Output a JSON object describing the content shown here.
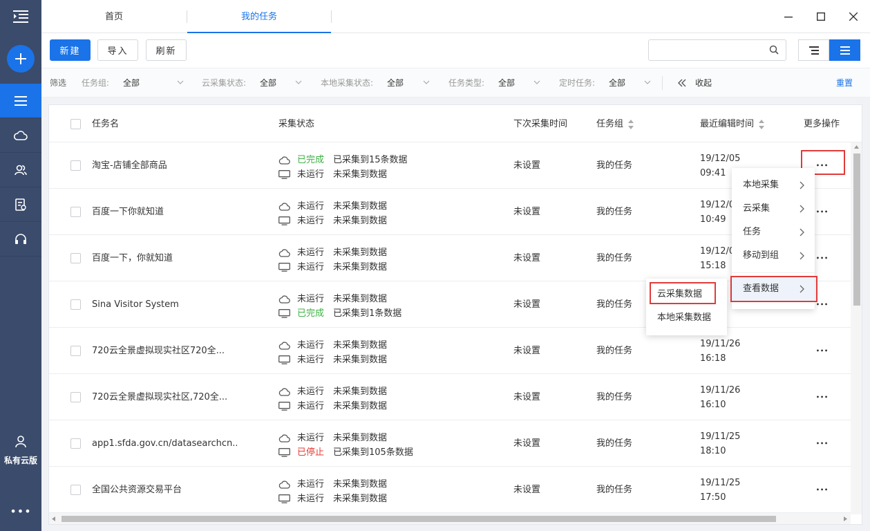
{
  "sidebar": {
    "user_label": "私有云版"
  },
  "tabs": [
    {
      "label": "首页"
    },
    {
      "label": "我的任务"
    }
  ],
  "toolbar": {
    "new_label": "新建",
    "import_label": "导入",
    "refresh_label": "刷新",
    "search_value": ""
  },
  "filters": {
    "label": "筛选",
    "task_group_label": "任务组:",
    "task_group_value": "全部",
    "cloud_status_label": "云采集状态:",
    "cloud_status_value": "全部",
    "local_status_label": "本地采集状态:",
    "local_status_value": "全部",
    "task_type_label": "任务类型:",
    "task_type_value": "全部",
    "scheduled_label": "定时任务:",
    "scheduled_value": "全部",
    "collapse_label": "收起",
    "reset_label": "重置"
  },
  "table": {
    "columns": {
      "name": "任务名",
      "status": "采集状态",
      "next_time": "下次采集时间",
      "group": "任务组",
      "edited": "最近编辑时间",
      "more": "更多操作"
    },
    "rows": [
      {
        "name": "淘宝-店铺全部商品",
        "cloud_state": "已完成",
        "cloud_state_type": "ok",
        "cloud_msg": "已采集到15条数据",
        "local_state": "未运行",
        "local_state_type": "",
        "local_msg": "未采集到数据",
        "next": "未设置",
        "group": "我的任务",
        "date": "19/12/05",
        "time": "09:41"
      },
      {
        "name": "百度一下你就知道",
        "cloud_state": "未运行",
        "cloud_state_type": "",
        "cloud_msg": "未采集到数据",
        "local_state": "未运行",
        "local_state_type": "",
        "local_msg": "未采集到数据",
        "next": "未设置",
        "group": "我的任务",
        "date": "19/12/0",
        "time": "10:49"
      },
      {
        "name": "百度一下，你就知道",
        "cloud_state": "未运行",
        "cloud_state_type": "",
        "cloud_msg": "未采集到数据",
        "local_state": "未运行",
        "local_state_type": "",
        "local_msg": "未采集到数据",
        "next": "未设置",
        "group": "我的任务",
        "date": "19/12/0",
        "time": "15:18"
      },
      {
        "name": "Sina Visitor System",
        "cloud_state": "未运行",
        "cloud_state_type": "",
        "cloud_msg": "未采集到数据",
        "local_state": "已完成",
        "local_state_type": "ok",
        "local_msg": "已采集到1条数据",
        "next": "未设置",
        "group": "我的任务",
        "date": "",
        "time": ""
      },
      {
        "name": "720云全景虚拟现实社区720全...",
        "cloud_state": "未运行",
        "cloud_state_type": "",
        "cloud_msg": "未采集到数据",
        "local_state": "未运行",
        "local_state_type": "",
        "local_msg": "未采集到数据",
        "next": "未设置",
        "group": "我的任务",
        "date": "19/11/26",
        "time": "16:18"
      },
      {
        "name": "720云全景虚拟现实社区,720全...",
        "cloud_state": "未运行",
        "cloud_state_type": "",
        "cloud_msg": "未采集到数据",
        "local_state": "未运行",
        "local_state_type": "",
        "local_msg": "未采集到数据",
        "next": "未设置",
        "group": "我的任务",
        "date": "19/11/26",
        "time": "16:10"
      },
      {
        "name": "app1.sfda.gov.cn/datasearchcn...",
        "cloud_state": "未运行",
        "cloud_state_type": "",
        "cloud_msg": "未采集到数据",
        "local_state": "已停止",
        "local_state_type": "stop",
        "local_msg": "已采集到105条数据",
        "next": "未设置",
        "group": "我的任务",
        "date": "19/11/25",
        "time": "18:10"
      },
      {
        "name": "全国公共资源交易平台",
        "cloud_state": "未运行",
        "cloud_state_type": "",
        "cloud_msg": "未采集到数据",
        "local_state": "未运行",
        "local_state_type": "",
        "local_msg": "未采集到数据",
        "next": "未设置",
        "group": "我的任务",
        "date": "19/11/25",
        "time": "17:50"
      }
    ]
  },
  "context_menu": {
    "items": [
      {
        "label": "本地采集"
      },
      {
        "label": "云采集"
      },
      {
        "label": "任务"
      },
      {
        "label": "移动到组"
      },
      {
        "label": "查看数据"
      }
    ]
  },
  "submenu": {
    "items": [
      {
        "label": "云采集数据"
      },
      {
        "label": "本地采集数据"
      }
    ]
  },
  "colors": {
    "accent": "#1a73e8",
    "sidebar": "#3b4b6b",
    "ok": "#3cb043",
    "stop": "#e53935",
    "highlight": "#e03a3a"
  }
}
